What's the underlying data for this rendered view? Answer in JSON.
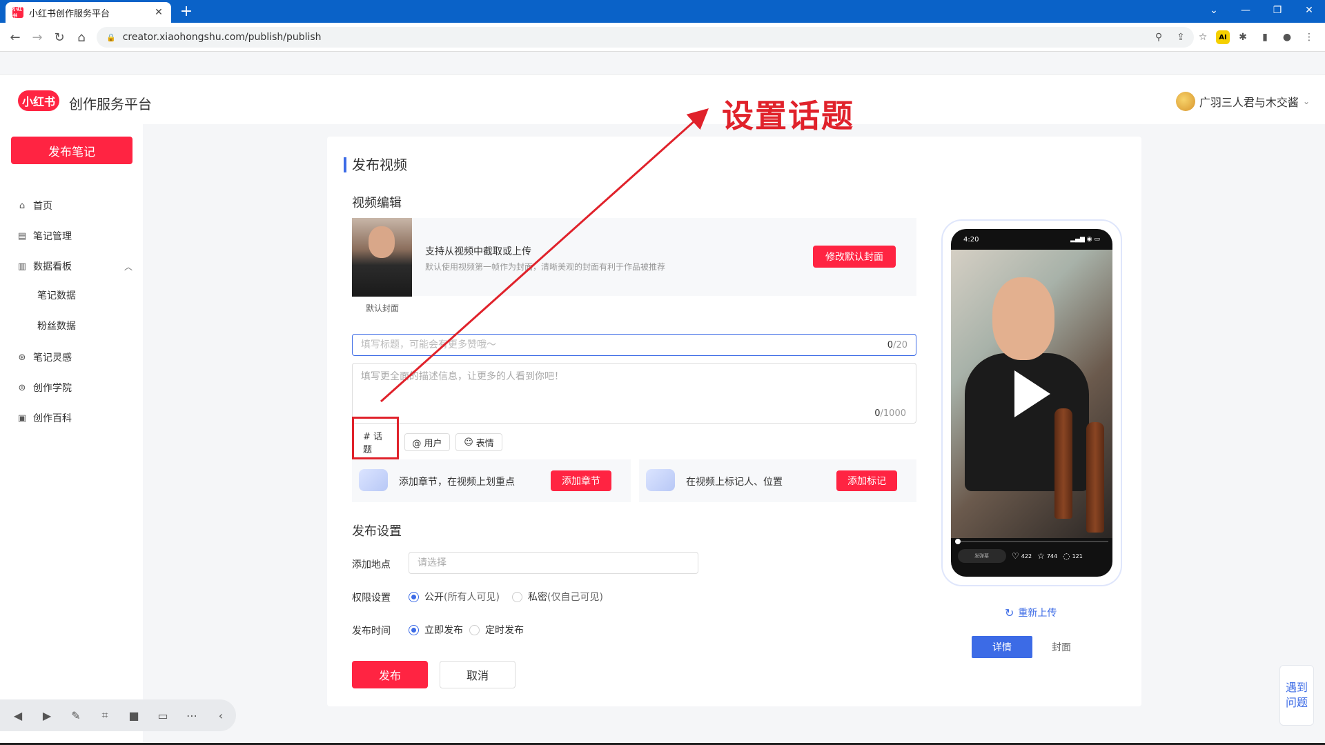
{
  "browser": {
    "tab_title": "小红书创作服务平台",
    "tab_favicon_text": "小红书",
    "url": "creator.xiaohongshu.com/publish/publish",
    "new_tab": "+",
    "tab_close": "✕"
  },
  "header": {
    "logo_text": "小红书",
    "platform_name": "创作服务平台",
    "username": "广羽三人君与木交酱"
  },
  "sidebar": {
    "publish_button": "发布笔记",
    "items": [
      {
        "label": "首页",
        "icon": "home-icon"
      },
      {
        "label": "笔记管理",
        "icon": "note-icon"
      },
      {
        "label": "数据看板",
        "icon": "chart-icon"
      },
      {
        "label": "笔记数据",
        "icon": ""
      },
      {
        "label": "粉丝数据",
        "icon": ""
      },
      {
        "label": "笔记灵感",
        "icon": "inspiration-icon"
      },
      {
        "label": "创作学院",
        "icon": "academy-icon"
      },
      {
        "label": "创作百科",
        "icon": "wiki-icon"
      }
    ]
  },
  "main": {
    "page_title": "发布视频",
    "video_edit_title": "视频编辑",
    "cover": {
      "label": "默认封面",
      "line1": "支持从视频中截取或上传",
      "line2": "默认使用视频第一帧作为封面，清晰美观的封面有利于作品被推荐",
      "edit_button": "修改默认封面"
    },
    "title_input": {
      "placeholder": "填写标题，可能会有更多赞哦～",
      "count": "0",
      "max": "/20"
    },
    "desc_input": {
      "placeholder": "填写更全面的描述信息，让更多的人看到你吧！",
      "count": "0",
      "max": "/1000"
    },
    "tags": {
      "topic": "# 话题",
      "user": "@ 用户",
      "emoji": "表情"
    },
    "chapter": {
      "text": "添加章节，在视频上划重点",
      "button": "添加章节"
    },
    "marker": {
      "text": "在视频上标记人、位置",
      "button": "添加标记"
    },
    "publish_settings_title": "发布设置",
    "location": {
      "label": "添加地点",
      "placeholder": "请选择"
    },
    "permission": {
      "label": "权限设置",
      "public": "公开",
      "public_sub": "(所有人可见)",
      "private": "私密",
      "private_sub": "(仅自己可见)"
    },
    "publish_time": {
      "label": "发布时间",
      "now": "立即发布",
      "scheduled": "定时发布"
    },
    "publish_button": "发布",
    "cancel_button": "取消"
  },
  "preview": {
    "status_time": "4:20",
    "comment_placeholder": "发弹幕",
    "likes": "422",
    "stars": "744",
    "comments": "121",
    "reupload": "重新上传",
    "tab_detail": "详情",
    "tab_cover": "封面"
  },
  "annotation": {
    "text": "设置话题",
    "color": "#e0222b"
  },
  "help": {
    "text": "遇到问题"
  },
  "colors": {
    "brand_red": "#ff2442",
    "accent_blue": "#3c6be6",
    "browser_blue": "#0a62c8"
  }
}
